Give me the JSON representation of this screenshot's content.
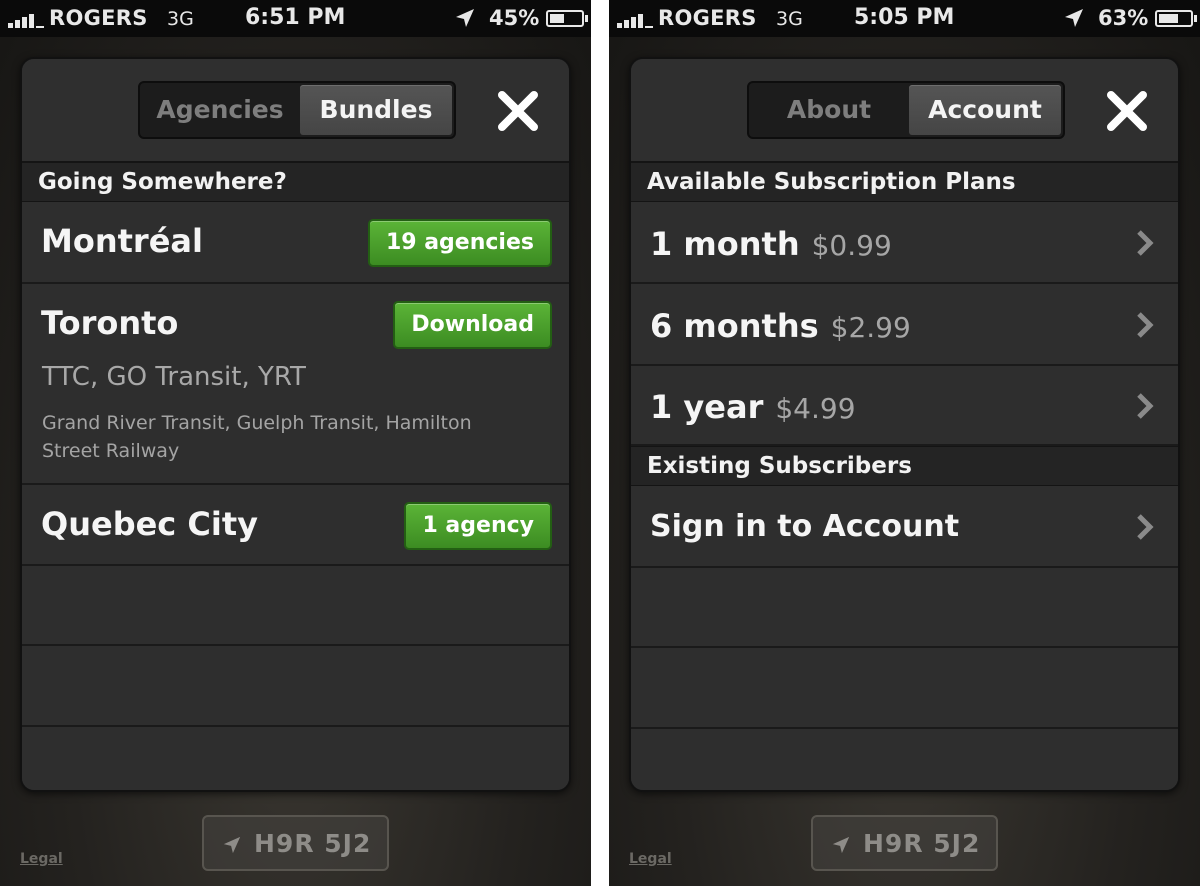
{
  "left": {
    "status": {
      "carrier": "ROGERS",
      "network": "3G",
      "time": "6:51 PM",
      "battery": "45%",
      "battery_level": 0.45
    },
    "tabs": {
      "left": "Agencies",
      "right": "Bundles",
      "active": "right"
    },
    "section_title": "Going Somewhere?",
    "rows": [
      {
        "title": "Montréal",
        "button": "19 agencies"
      },
      {
        "title": "Toronto",
        "button": "Download",
        "subtitle": "TTC, GO Transit, YRT",
        "details": "Grand River Transit, Guelph Transit, Hamilton Street Railway"
      },
      {
        "title": "Quebec City",
        "button": "1 agency"
      }
    ],
    "location": "H9R 5J2",
    "legal": "Legal"
  },
  "right": {
    "status": {
      "carrier": "ROGERS",
      "network": "3G",
      "time": "5:05 PM",
      "battery": "63%",
      "battery_level": 0.63
    },
    "tabs": {
      "left": "About",
      "right": "Account",
      "active": "right"
    },
    "section_plans": "Available Subscription Plans",
    "plans": [
      {
        "duration": "1 month",
        "price": "$0.99"
      },
      {
        "duration": "6 months",
        "price": "$2.99"
      },
      {
        "duration": "1 year",
        "price": "$4.99"
      }
    ],
    "section_existing": "Existing Subscribers",
    "sign_in": "Sign in to Account",
    "location": "H9R 5J2",
    "legal": "Legal"
  },
  "colors": {
    "accent_green": "#4da52d",
    "panel": "#2e2e2e",
    "status_bar": "#0a0a0a"
  },
  "icons": [
    "signal-bars-icon",
    "location-arrow-icon",
    "battery-icon",
    "close-icon",
    "chevron-right-icon"
  ]
}
